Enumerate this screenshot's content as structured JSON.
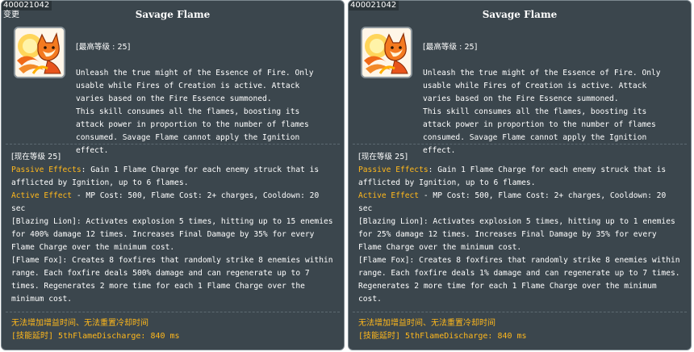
{
  "tooltips": [
    {
      "skill_id": "400021042",
      "tag": "变更",
      "title": "Savage Flame",
      "max_level": "[最高等级 : 25]",
      "description": "Unleash the true might of the Essence of Fire. Only\nusable while Fires of Creation is active. Attack\nvaries based on the Fire Essence summoned.\nThis skill consumes all the flames, boosting its\nattack power in proportion to the number of flames\nconsumed. Savage Flame cannot apply the Ignition\neffect.",
      "current_level": "[现在等级 25]",
      "passive_label": "Passive Effects",
      "passive_text": ": Gain 1 Flame Charge for each enemy struck that is afflicted by Ignition, up to 6 flames.",
      "active_label": "Active Effect",
      "active_text": " - MP Cost: 500, Flame Cost: 2+ charges, Cooldown: 20 sec",
      "blazing_lion": "[Blazing Lion]: Activates explosion 5 times, hitting up to 15 enemies for 400% damage 12 times. Increases Final Damage by 35% for every Flame Charge over the minimum cost.",
      "flame_fox": "[Flame Fox]: Creates 8 foxfires that randomly strike 8 enemies within range. Each foxfire deals 500% damage and can regenerate up to 7 times. Regenerates 2 more time for each 1 Flame Charge over the minimum cost.",
      "footer_line1": "无法增加增益时间、无法重置冷却时间",
      "footer_line2": "[技能延时] 5thFlameDischarge: 840 ms"
    },
    {
      "skill_id": "400021042",
      "tag": "",
      "title": "Savage Flame",
      "max_level": "[最高等级 : 25]",
      "description": "Unleash the true might of the Essence of Fire. Only\nusable while Fires of Creation is active. Attack\nvaries based on the Fire Essence summoned.\nThis skill consumes all the flames, boosting its\nattack power in proportion to the number of flames\nconsumed. Savage Flame cannot apply the Ignition\neffect.",
      "current_level": "[现在等级 25]",
      "passive_label": "Passive Effects",
      "passive_text": ": Gain 1 Flame Charge for each enemy struck that is afflicted by Ignition, up to 6 flames.",
      "active_label": "Active Effect",
      "active_text": " - MP Cost: 500, Flame Cost: 2+ charges, Cooldown: 20 sec",
      "blazing_lion": "[Blazing Lion]: Activates explosion 5 times, hitting up to 1 enemies for 25% damage 12 times. Increases Final Damage by 35% for every Flame Charge over the minimum cost.",
      "flame_fox": "[Flame Fox]: Creates 8 foxfires that randomly strike 8 enemies within range. Each foxfire deals 1% damage and can regenerate up to 7 times. Regenerates 2 more time for each 1 Flame Charge over the minimum cost.",
      "footer_line1": "无法增加增益时间、无法重置冷却时间",
      "footer_line2": "[技能延时] 5thFlameDischarge: 840 ms"
    }
  ],
  "colors": {
    "panel_bg": "#3b464d",
    "highlight": "#ffb81c",
    "text": "#ffffff"
  },
  "icons": {
    "skill_icon": "fire-fox-icon"
  }
}
